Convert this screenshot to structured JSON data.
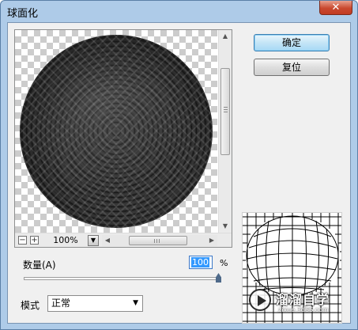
{
  "window": {
    "title": "球面化",
    "close_label": "✕"
  },
  "preview": {
    "zoom_minus": "−",
    "zoom_plus": "+",
    "zoom_value": "100%",
    "zoom_dropdown_icon": "triangle-down-icon",
    "vscroll_icon": "scrollbar-vertical",
    "hscroll_grip": "III"
  },
  "buttons": {
    "ok_label": "确定",
    "reset_label": "复位"
  },
  "amount": {
    "label": "数量(A)",
    "value": "100",
    "unit": "%",
    "slider_fraction": 1.0
  },
  "mode": {
    "label": "模式",
    "selected": "正常"
  },
  "watermark": {
    "title": "溜溜自学",
    "url": "zixue.3d66.com"
  }
}
